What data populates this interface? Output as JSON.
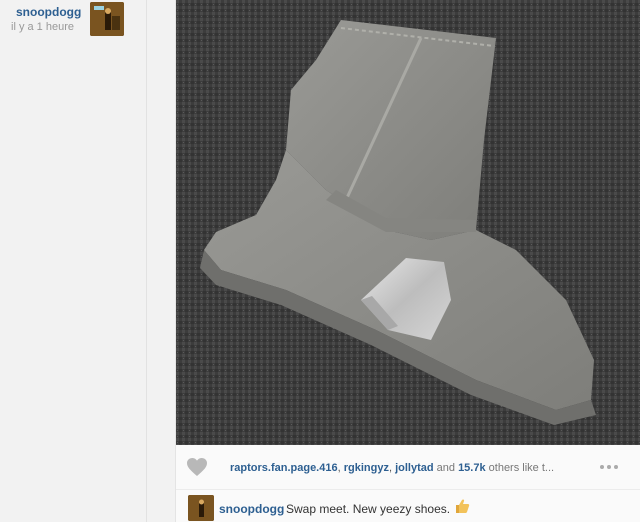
{
  "sidebar": {
    "username": "snoopdogg",
    "timestamp": "il y a 1 heure"
  },
  "post": {
    "likes": {
      "user1": "raptors.fan.page.416",
      "sep1": ", ",
      "user2": "rgkingyz",
      "sep2": ", ",
      "user3": "jollytad",
      "and_text": " and ",
      "count": "15.7k",
      "others_text": " others like t..."
    },
    "caption": {
      "username": "snoopdogg",
      "text": "Swap meet. New yeezy shoes."
    }
  },
  "colors": {
    "link": "#2d5f91",
    "background": "#f2f2f2",
    "card": "#ffffff"
  },
  "icons": [
    "heart-icon",
    "more-options-icon",
    "thumbs-up-emoji-icon"
  ]
}
